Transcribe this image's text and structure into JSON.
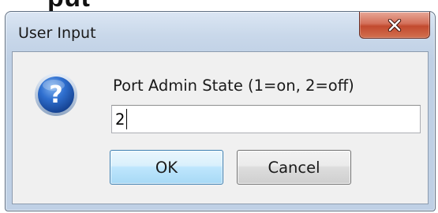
{
  "background": {
    "partial_title": "put"
  },
  "window": {
    "title": "User Input",
    "close_icon": "close-x-icon"
  },
  "dialog": {
    "icon": "question-icon",
    "prompt": "Port Admin State (1=on, 2=off)",
    "input_value": "2",
    "ok_label": "OK",
    "cancel_label": "Cancel"
  },
  "colors": {
    "close_button": "#c24a2f",
    "ok_border": "#3c7fb1",
    "question_icon_blue": "#1f5fb8"
  }
}
